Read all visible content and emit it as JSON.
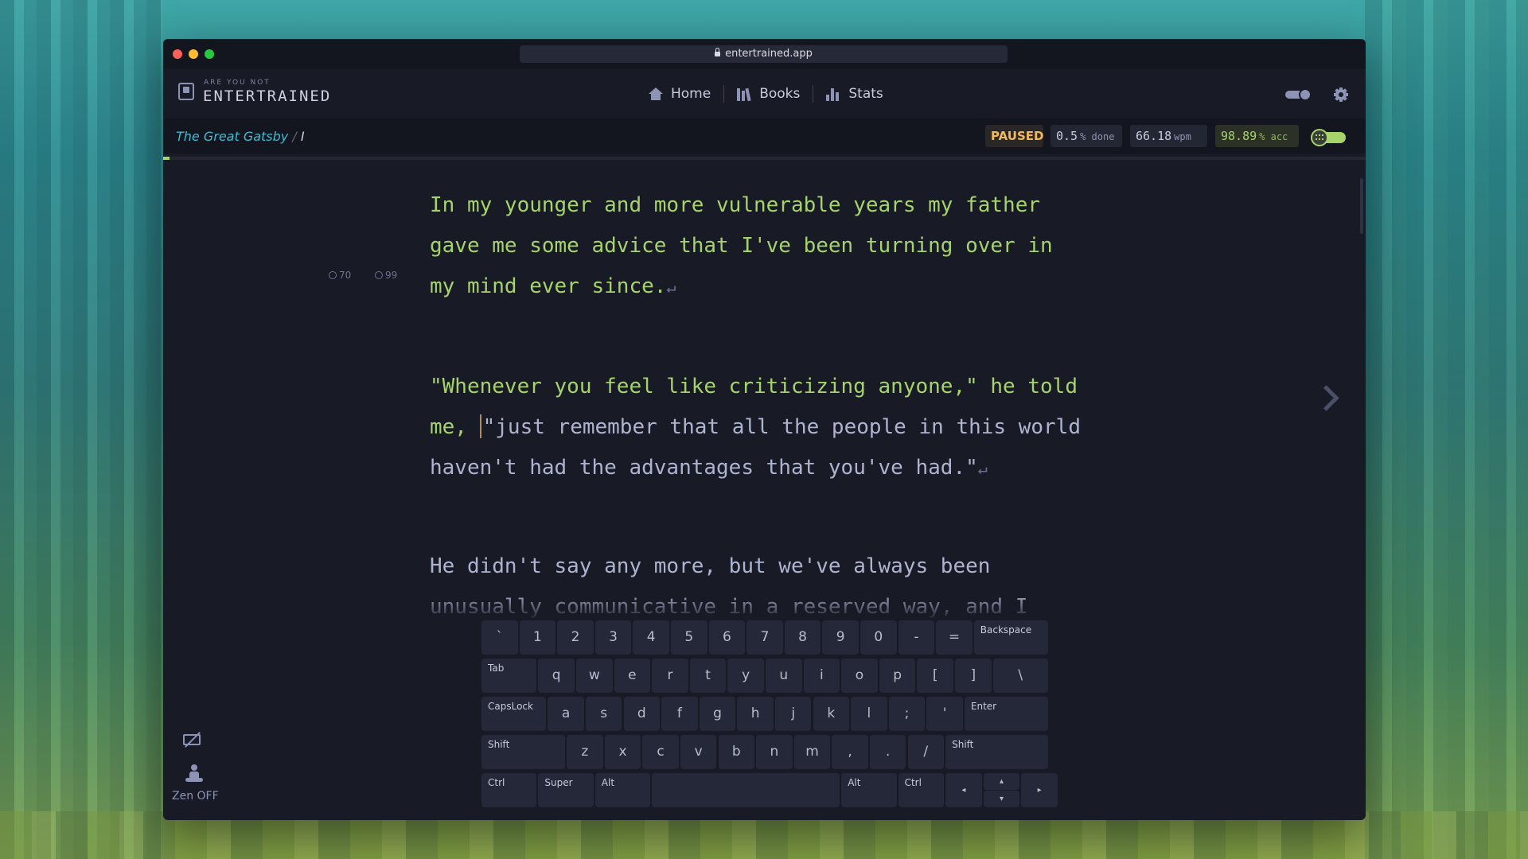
{
  "browser": {
    "url": "entertrained.app"
  },
  "app": {
    "logo_small": "ARE YOU NOT",
    "logo_big": "ENTERTRAINED"
  },
  "nav": [
    {
      "label": "Home",
      "icon": "home-icon"
    },
    {
      "label": "Books",
      "icon": "books-icon"
    },
    {
      "label": "Stats",
      "icon": "stats-icon"
    }
  ],
  "header_icons": {
    "theme": "theme-toggle-icon",
    "settings": "gear-icon"
  },
  "breadcrumb": {
    "book": "The Great Gatsby",
    "separator": "/",
    "chapter": "I"
  },
  "stats": {
    "status": "PAUSED",
    "progress_value": "0.5",
    "progress_unit": "% done",
    "wpm_value": "66.18",
    "wpm_unit": "wpm",
    "acc_value": "98.89",
    "acc_unit": "% acc"
  },
  "progress_fraction": 0.005,
  "paragraphs": [
    {
      "typed": "In my younger and more vulnerable years my father gave me some advice that I've been turning over in my mind ever since.",
      "untyped": "",
      "return_mark": "↵",
      "meta": {
        "wpm": "70",
        "accuracy": "99"
      }
    },
    {
      "typed": "\"Whenever you feel like criticizing anyone,\" he told me, ",
      "untyped": "\"just remember that all the people in this world haven't had the advantages that you've had.\"",
      "return_mark": "↵"
    },
    {
      "typed": "",
      "untyped": "He didn't say any more, but we've always been unusually communicative in a reserved way, and I understood that he meant a great deal more than that.",
      "return_mark": ""
    }
  ],
  "keyboard": {
    "rows": [
      [
        {
          "label": "`",
          "w": 1
        },
        {
          "label": "1",
          "w": 1
        },
        {
          "label": "2",
          "w": 1
        },
        {
          "label": "3",
          "w": 1
        },
        {
          "label": "4",
          "w": 1
        },
        {
          "label": "5",
          "w": 1
        },
        {
          "label": "6",
          "w": 1
        },
        {
          "label": "7",
          "w": 1
        },
        {
          "label": "8",
          "w": 1
        },
        {
          "label": "9",
          "w": 1
        },
        {
          "label": "0",
          "w": 1
        },
        {
          "label": "-",
          "w": 1
        },
        {
          "label": "=",
          "w": 1
        },
        {
          "label": "Backspace",
          "w": 2,
          "mod": true
        }
      ],
      [
        {
          "label": "Tab",
          "w": 1.5,
          "mod": true
        },
        {
          "label": "q",
          "w": 1
        },
        {
          "label": "w",
          "w": 1
        },
        {
          "label": "e",
          "w": 1
        },
        {
          "label": "r",
          "w": 1
        },
        {
          "label": "t",
          "w": 1
        },
        {
          "label": "y",
          "w": 1
        },
        {
          "label": "u",
          "w": 1
        },
        {
          "label": "i",
          "w": 1
        },
        {
          "label": "o",
          "w": 1
        },
        {
          "label": "p",
          "w": 1
        },
        {
          "label": "[",
          "w": 1
        },
        {
          "label": "]",
          "w": 1
        },
        {
          "label": "\\",
          "w": 1.5
        }
      ],
      [
        {
          "label": "CapsLock",
          "w": 1.75,
          "mod": true
        },
        {
          "label": "a",
          "w": 1
        },
        {
          "label": "s",
          "w": 1
        },
        {
          "label": "d",
          "w": 1
        },
        {
          "label": "f",
          "w": 1
        },
        {
          "label": "g",
          "w": 1
        },
        {
          "label": "h",
          "w": 1
        },
        {
          "label": "j",
          "w": 1
        },
        {
          "label": "k",
          "w": 1
        },
        {
          "label": "l",
          "w": 1
        },
        {
          "label": ";",
          "w": 1
        },
        {
          "label": "'",
          "w": 1
        },
        {
          "label": "Enter",
          "w": 2.25,
          "mod": true
        }
      ],
      [
        {
          "label": "Shift",
          "w": 2.25,
          "mod": true
        },
        {
          "label": "z",
          "w": 1
        },
        {
          "label": "x",
          "w": 1
        },
        {
          "label": "c",
          "w": 1
        },
        {
          "label": "v",
          "w": 1
        },
        {
          "label": "b",
          "w": 1
        },
        {
          "label": "n",
          "w": 1
        },
        {
          "label": "m",
          "w": 1
        },
        {
          "label": ",",
          "w": 1
        },
        {
          "label": ".",
          "w": 1
        },
        {
          "label": "/",
          "w": 1
        },
        {
          "label": "Shift",
          "w": 2.75,
          "mod": true
        }
      ],
      [
        {
          "label": "Ctrl",
          "w": 1.5,
          "mod": true
        },
        {
          "label": "Super",
          "w": 1.5,
          "mod": true
        },
        {
          "label": "Alt",
          "w": 1.5,
          "mod": true
        },
        {
          "label": "",
          "w": 5
        },
        {
          "label": "Alt",
          "w": 1.5,
          "mod": true
        },
        {
          "label": "Ctrl",
          "w": 1.25,
          "mod": true
        },
        {
          "label": "◂",
          "w": 1,
          "arrow": true
        },
        {
          "label": "▴▾",
          "w": 1,
          "arrow": true,
          "split": true
        },
        {
          "label": "▸",
          "w": 1,
          "arrow": true
        }
      ]
    ]
  },
  "side": {
    "keyboard_toggle_icon": "keyboard-off-icon",
    "zen_icon": "meditation-icon",
    "zen_label": "Zen OFF"
  }
}
